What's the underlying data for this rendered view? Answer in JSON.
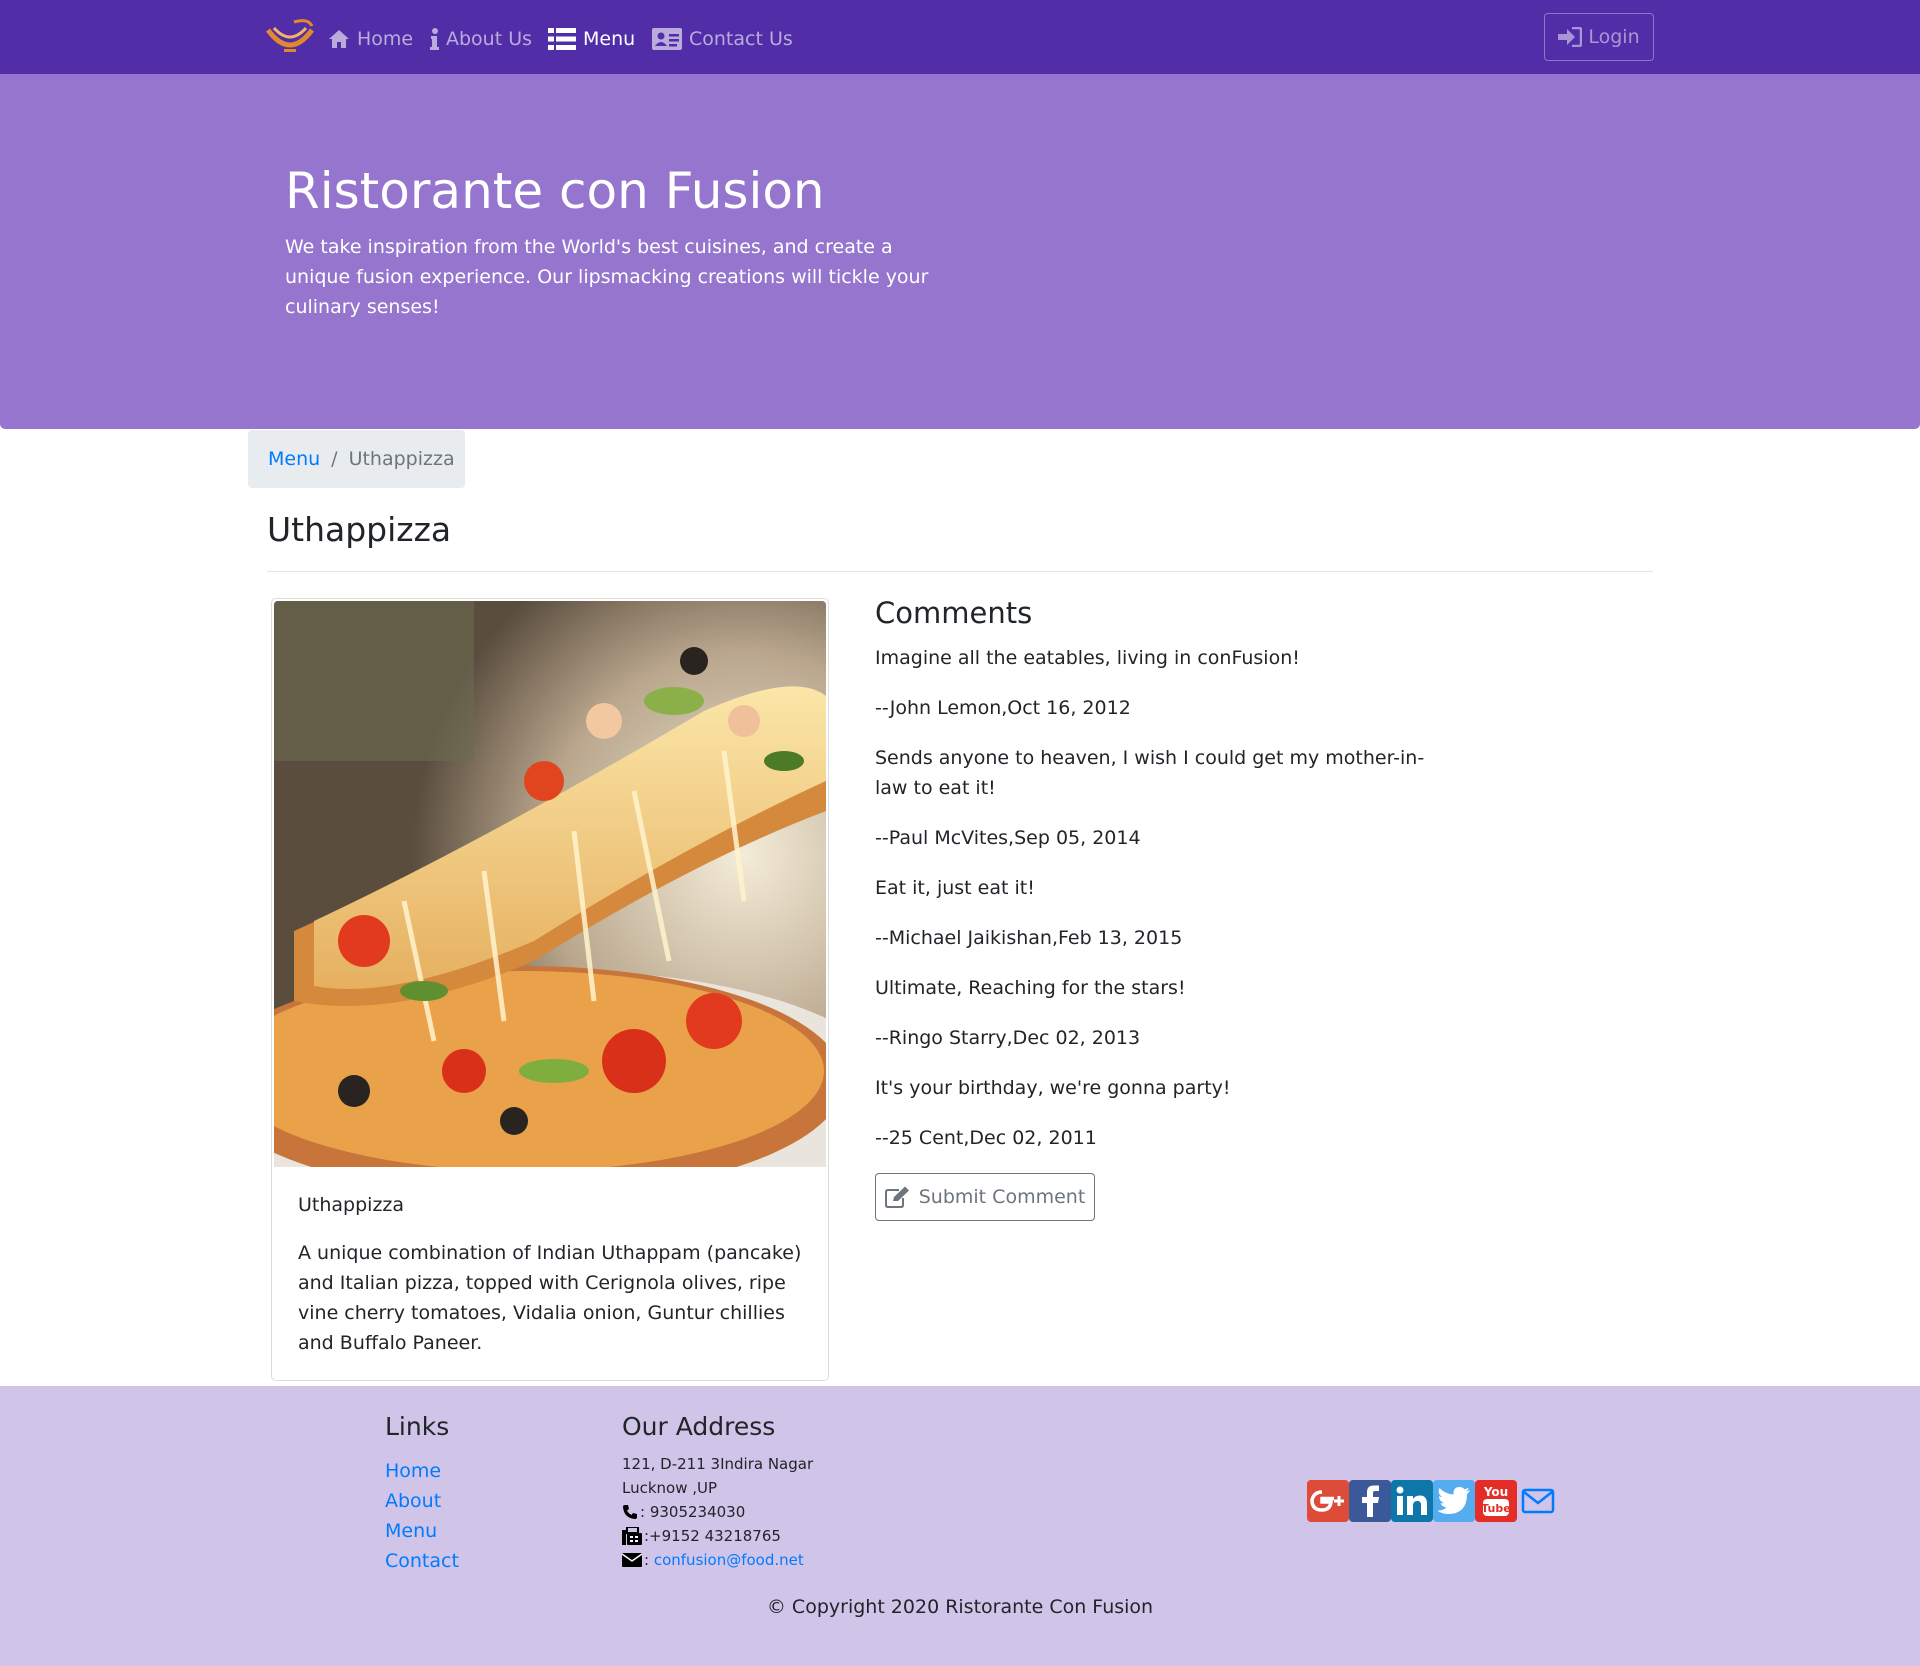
{
  "nav": {
    "home": "Home",
    "about": "About Us",
    "menu": "Menu",
    "contact": "Contact Us",
    "login": "Login"
  },
  "jumbotron": {
    "title": "Ristorante con Fusion",
    "text": "We take inspiration from the World's best cuisines, and create a unique fusion experience. Our lipsmacking creations will tickle your culinary senses!"
  },
  "breadcrumb": {
    "parent": "Menu",
    "separator": "/",
    "current": "Uthappizza"
  },
  "dish": {
    "heading": "Uthappizza",
    "name": "Uthappizza",
    "description": "A unique combination of Indian Uthappam (pancake) and Italian pizza, topped with Cerignola olives, ripe vine cherry tomatoes, Vidalia onion, Guntur chillies and Buffalo Paneer."
  },
  "comments": {
    "heading": "Comments",
    "items": [
      {
        "text": "Imagine all the eatables, living in conFusion!",
        "author": "--John Lemon,Oct 16, 2012"
      },
      {
        "text": "Sends anyone to heaven, I wish I could get my mother-in-law to eat it!",
        "author": "--Paul McVites,Sep 05, 2014"
      },
      {
        "text": "Eat it, just eat it!",
        "author": "--Michael Jaikishan,Feb 13, 2015"
      },
      {
        "text": "Ultimate, Reaching for the stars!",
        "author": "--Ringo Starry,Dec 02, 2013"
      },
      {
        "text": "It's your birthday, we're gonna party!",
        "author": "--25 Cent,Dec 02, 2011"
      }
    ],
    "submit_label": "Submit Comment"
  },
  "footer": {
    "links_heading": "Links",
    "links": [
      "Home",
      "About",
      "Menu",
      "Contact"
    ],
    "address_heading": "Our Address",
    "address_line1": "121, D-211 3Indira Nagar",
    "address_line2": "Lucknow ,UP",
    "phone": ": 9305234030",
    "fax": ":+9152 43218765",
    "email": "confusion@food.net",
    "email_prefix": ":",
    "social_icons": [
      "google-plus-icon",
      "facebook-icon",
      "linkedin-icon",
      "twitter-icon",
      "youtube-icon",
      "mail-icon"
    ],
    "copyright": "© Copyright 2020 Ristorante Con Fusion"
  },
  "colors": {
    "primary_dark": "#512DA8",
    "primary": "#9575CD",
    "primary_light": "#D1C4E9",
    "link": "#007bff"
  }
}
